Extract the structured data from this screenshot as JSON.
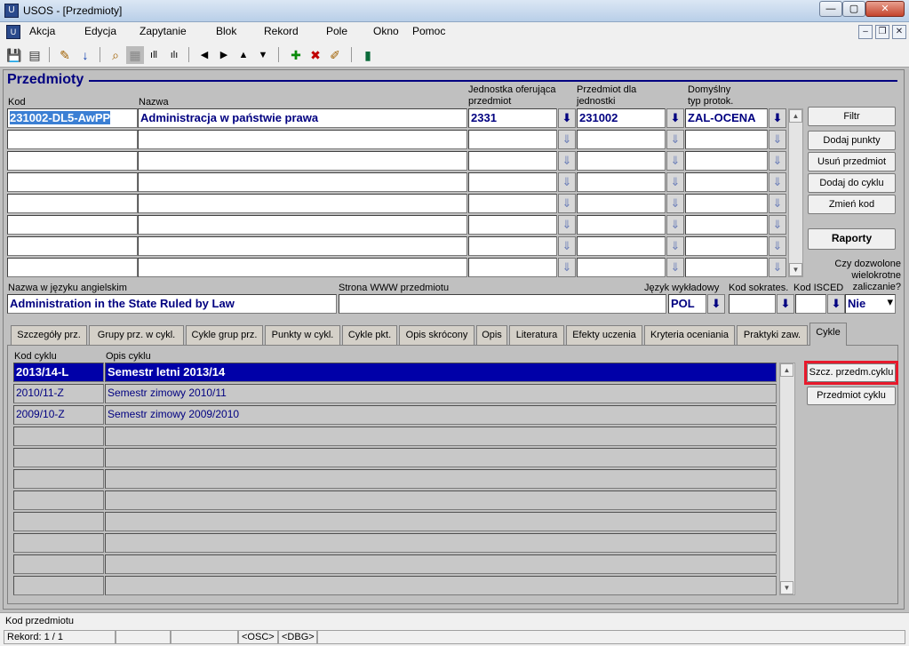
{
  "window": {
    "title": "USOS - [Przedmioty]",
    "min": "—",
    "max": "▢",
    "close": "✕"
  },
  "menu": {
    "items": [
      "Akcja",
      "Edycja",
      "Zapytanie",
      "Blok",
      "Rekord",
      "Pole",
      "Okno",
      "Pomoc"
    ],
    "mdi": {
      "min": "–",
      "restore": "❐",
      "close": "✕"
    }
  },
  "toolbar": {
    "icons": [
      "save-icon",
      "print-icon",
      "edit-icon",
      "download-icon",
      "query-icon",
      "query-disabled-icon",
      "count-icon",
      "count-all-icon",
      "prev-icon",
      "next-icon",
      "up-icon",
      "down-icon",
      "insert-icon",
      "delete-icon",
      "clear-icon",
      "exit-icon"
    ],
    "glyphs": {
      "save": "💾",
      "print": "▤",
      "edit": "✎",
      "download": "↓",
      "query": "⌕",
      "query_dis": "▦",
      "count": "ıll",
      "count_all": "ılı",
      "prev": "◀",
      "next": "▶",
      "up": "▲",
      "down": "▼",
      "insert": "✚",
      "delete": "✖",
      "clear": "✐",
      "exit": "▮"
    }
  },
  "block": {
    "title": "Przedmioty",
    "labels": {
      "kod": "Kod",
      "nazwa": "Nazwa",
      "jednostka_1": "Jednostka oferująca",
      "jednostka_2": "przedmiot",
      "przedmiot_dla_1": "Przedmiot dla",
      "przedmiot_dla_2": "jednostki",
      "domyslny_1": "Domyślny",
      "domyslny_2": "typ protok."
    },
    "rows": [
      {
        "kod": "231002-DL5-AwPP",
        "nazwa": "Administracja w państwie prawa",
        "jednostka": "2331",
        "przedmiot_dla": "231002",
        "typ": "ZAL-OCENA"
      },
      {
        "kod": "",
        "nazwa": "",
        "jednostka": "",
        "przedmiot_dla": "",
        "typ": ""
      },
      {
        "kod": "",
        "nazwa": "",
        "jednostka": "",
        "przedmiot_dla": "",
        "typ": ""
      },
      {
        "kod": "",
        "nazwa": "",
        "jednostka": "",
        "przedmiot_dla": "",
        "typ": ""
      },
      {
        "kod": "",
        "nazwa": "",
        "jednostka": "",
        "przedmiot_dla": "",
        "typ": ""
      },
      {
        "kod": "",
        "nazwa": "",
        "jednostka": "",
        "przedmiot_dla": "",
        "typ": ""
      },
      {
        "kod": "",
        "nazwa": "",
        "jednostka": "",
        "przedmiot_dla": "",
        "typ": ""
      },
      {
        "kod": "",
        "nazwa": "",
        "jednostka": "",
        "przedmiot_dla": "",
        "typ": ""
      }
    ],
    "lov_glyph": "⇓",
    "lov_glyph_active": "⬇"
  },
  "side_buttons": {
    "filtr": "Filtr",
    "dodaj_punkty": "Dodaj punkty",
    "usun": "Usuń przedmiot",
    "dodaj_cykl": "Dodaj do cyklu",
    "zmien_kod": "Zmień kod",
    "raporty": "Raporty"
  },
  "details": {
    "label_nazwa_ang": "Nazwa w języku angielskim",
    "label_www": "Strona WWW  przedmiotu",
    "label_jezyk": "Język wykładowy",
    "label_sokrates": "Kod sokrates.",
    "label_isced": "Kod ISCED",
    "label_wielokrotne_1": "Czy dozwolone",
    "label_wielokrotne_2": "wielokrotne",
    "label_wielokrotne_3": "zaliczanie?",
    "nazwa_ang": "Administration in the State Ruled by Law",
    "www": "",
    "jezyk": "POL",
    "sokrates": "",
    "isced": "",
    "wielokrotne": "Nie",
    "dropdown_glyph": "▾"
  },
  "tabs": [
    "Szczegóły prz.",
    "Grupy prz. w cykl.",
    "Cykle grup prz.",
    "Punkty w cykl.",
    "Cykle pkt.",
    "Opis skrócony",
    "Opis",
    "Literatura",
    "Efekty uczenia",
    "Kryteria oceniania",
    "Praktyki zaw.",
    "Cykle"
  ],
  "cykle": {
    "col_kod": "Kod cyklu",
    "col_opis": "Opis cyklu",
    "rows": [
      {
        "kod": "2013/14-L",
        "opis": "Semestr letni 2013/14"
      },
      {
        "kod": "2010/11-Z",
        "opis": "Semestr zimowy 2010/11"
      },
      {
        "kod": "2009/10-Z",
        "opis": "Semestr zimowy 2009/2010"
      },
      {
        "kod": "",
        "opis": ""
      },
      {
        "kod": "",
        "opis": ""
      },
      {
        "kod": "",
        "opis": ""
      },
      {
        "kod": "",
        "opis": ""
      },
      {
        "kod": "",
        "opis": ""
      },
      {
        "kod": "",
        "opis": ""
      },
      {
        "kod": "",
        "opis": ""
      },
      {
        "kod": "",
        "opis": ""
      }
    ],
    "btn_szcz": "Szcz. przedm.cyklu",
    "btn_przedmiot": "Przedmiot cyklu",
    "highlight_color": "#e8192c"
  },
  "scroll": {
    "up": "▲",
    "down": "▼"
  },
  "status": {
    "hint": "Kod przedmiotu",
    "rekord": "Rekord: 1 / 1",
    "osc": "<OSC>",
    "dbg": "<DBG>"
  }
}
